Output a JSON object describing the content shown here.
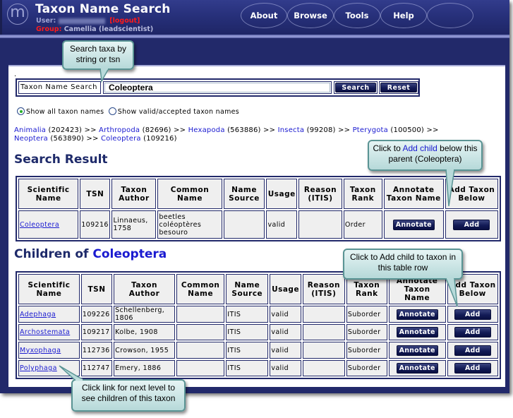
{
  "header": {
    "logo_glyph": "m",
    "title": "Taxon Name Search",
    "user_label": "User:",
    "logout_label": "[logout]",
    "group_label": "Group:",
    "group_value": "Camellia (leadscientist)"
  },
  "nav": {
    "items": [
      {
        "label": "About"
      },
      {
        "label": "Browse"
      },
      {
        "label": "Tools"
      },
      {
        "label": "Help"
      }
    ]
  },
  "search": {
    "label": "Taxon Name Search",
    "value": "Coleoptera",
    "search_button": "Search",
    "reset_button": "Reset",
    "radio_all": "Show all taxon names",
    "radio_valid": "Show valid/accepted taxon names",
    "selected": "all"
  },
  "breadcrumb": {
    "items": [
      {
        "name": "Animalia",
        "tsn": "(202423)"
      },
      {
        "name": "Arthropoda",
        "tsn": "(82696)"
      },
      {
        "name": "Hexapoda",
        "tsn": "(563886)"
      },
      {
        "name": "Insecta",
        "tsn": "(99208)"
      },
      {
        "name": "Pterygota",
        "tsn": "(100500)"
      },
      {
        "name": "Neoptera",
        "tsn": "(563890)"
      },
      {
        "name": "Coleoptera",
        "tsn": "(109216)"
      }
    ],
    "separator": ">>"
  },
  "search_result": {
    "heading": "Search Result",
    "columns": [
      "Scientific Name",
      "TSN",
      "Taxon Author",
      "Common Name",
      "Name Source",
      "Usage",
      "Reason (ITIS)",
      "Taxon Rank",
      "Annotate Taxon Name",
      "Add Taxon Below"
    ],
    "rows": [
      {
        "scientific_name": "Coleoptera",
        "tsn": "109216",
        "author": "Linnaeus, 1758",
        "common_name": [
          "beetles",
          "coléoptères",
          "besouro"
        ],
        "name_source": "",
        "usage": "valid",
        "reason": "",
        "rank": "Order",
        "annotate": "Annotate",
        "add": "Add"
      }
    ]
  },
  "children": {
    "heading_prefix": "Children of",
    "heading_taxon": "Coleoptera",
    "columns": [
      "Scientific Name",
      "TSN",
      "Taxon Author",
      "Common Name",
      "Name Source",
      "Usage",
      "Reason (ITIS)",
      "Taxon Rank",
      "Annotate Taxon Name",
      "Add Taxon Below"
    ],
    "rows": [
      {
        "scientific_name": "Adephaga",
        "tsn": "109226",
        "author": "Schellenberg, 1806",
        "common_name": "",
        "name_source": "ITIS",
        "usage": "valid",
        "reason": "",
        "rank": "Suborder",
        "annotate": "Annotate",
        "add": "Add"
      },
      {
        "scientific_name": "Archostemata",
        "tsn": "109217",
        "author": "Kolbe, 1908",
        "common_name": "",
        "name_source": "ITIS",
        "usage": "valid",
        "reason": "",
        "rank": "Suborder",
        "annotate": "Annotate",
        "add": "Add"
      },
      {
        "scientific_name": "Myxophaga",
        "tsn": "112736",
        "author": "Crowson, 1955",
        "common_name": "",
        "name_source": "ITIS",
        "usage": "valid",
        "reason": "",
        "rank": "Suborder",
        "annotate": "Annotate",
        "add": "Add"
      },
      {
        "scientific_name": "Polyphaga",
        "tsn": "112747",
        "author": "Emery, 1886",
        "common_name": "",
        "name_source": "ITIS",
        "usage": "valid",
        "reason": "",
        "rank": "Suborder",
        "annotate": "Annotate",
        "add": "Add"
      }
    ]
  },
  "callouts": {
    "search": "Search taxa by string or tsn",
    "add_parent_pre": "Click to",
    "add_parent_hl": "Add child",
    "add_parent_post": "below this parent (Coleoptera)",
    "add_row": "Click to Add child to taxon in this table row",
    "next_level": "Click link for next level to see children of this taxon"
  }
}
